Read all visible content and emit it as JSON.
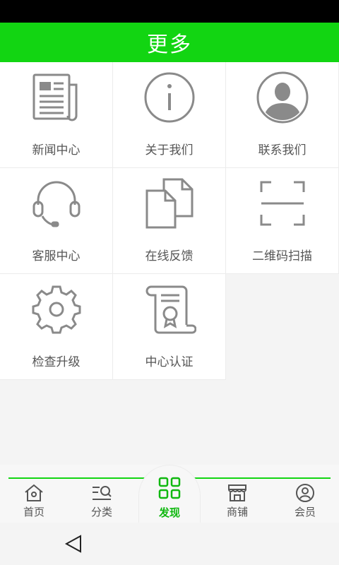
{
  "header": {
    "title": "更多"
  },
  "grid": {
    "items": [
      {
        "label": "新闻中心",
        "icon": "newspaper-icon"
      },
      {
        "label": "关于我们",
        "icon": "info-icon"
      },
      {
        "label": "联系我们",
        "icon": "person-icon"
      },
      {
        "label": "客服中心",
        "icon": "headset-icon"
      },
      {
        "label": "在线反馈",
        "icon": "documents-icon"
      },
      {
        "label": "二维码扫描",
        "icon": "scan-icon"
      },
      {
        "label": "检查升级",
        "icon": "gear-icon"
      },
      {
        "label": "中心认证",
        "icon": "certificate-scroll-icon"
      }
    ]
  },
  "tabbar": {
    "tabs": [
      {
        "label": "首页",
        "icon": "home-icon"
      },
      {
        "label": "分类",
        "icon": "category-search-icon"
      },
      {
        "label": "发现",
        "icon": "grid-icon",
        "active": true
      },
      {
        "label": "商铺",
        "icon": "store-icon"
      },
      {
        "label": "会员",
        "icon": "user-circle-icon"
      }
    ]
  },
  "colors": {
    "accent": "#12d512",
    "icon_gray": "#8a8a8a",
    "text_gray": "#555555"
  }
}
